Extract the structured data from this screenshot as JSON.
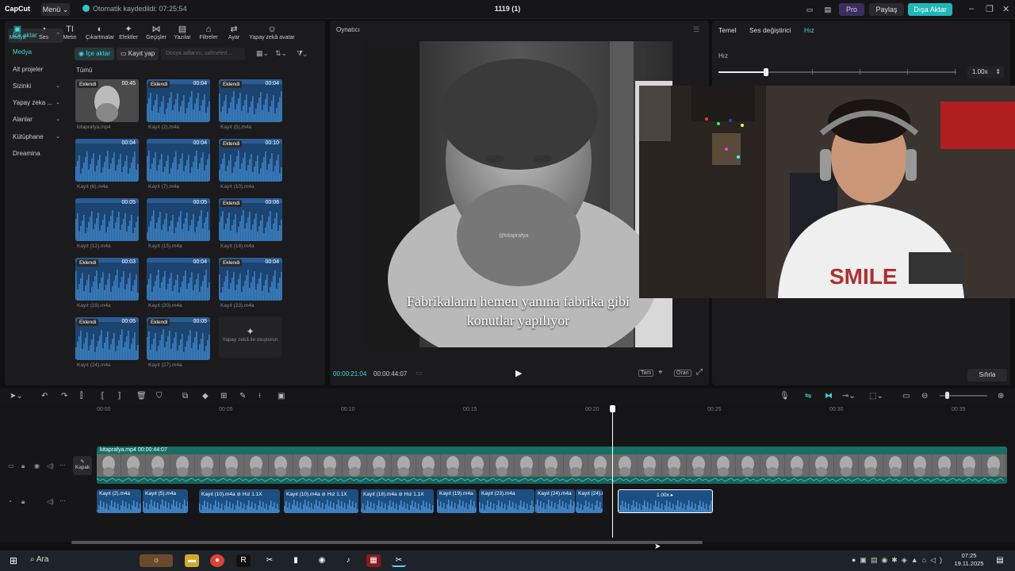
{
  "titlebar": {
    "logo": "CapCut",
    "menu": "Menü ⌄",
    "autosave": "Otomatik kaydedildi: 07:25:54",
    "project_title": "1119 (1)",
    "pro": "Pro",
    "share": "Paylaş",
    "export": "Dışa Aktar"
  },
  "categories": [
    {
      "label": "Medya",
      "icon": "▣"
    },
    {
      "label": "Ses",
      "icon": "◔"
    },
    {
      "label": "Metin",
      "icon": "TI"
    },
    {
      "label": "Çıkartmalar",
      "icon": "◐"
    },
    {
      "label": "Efektler",
      "icon": "✦"
    },
    {
      "label": "Geçişler",
      "icon": "⋈"
    },
    {
      "label": "Yazılar",
      "icon": "▤"
    },
    {
      "label": "Filtreler",
      "icon": "⌂"
    },
    {
      "label": "Ayar",
      "icon": "⇄"
    },
    {
      "label": "Yapay zekâ avatar",
      "icon": "☺"
    }
  ],
  "sidenav": [
    {
      "label": "İçe aktar",
      "chev": "⌃"
    },
    {
      "label": "Medya",
      "chev": ""
    },
    {
      "label": "Alt projeler",
      "chev": ""
    },
    {
      "label": "Sizinki",
      "chev": "⌄"
    },
    {
      "label": "Yapay zeka ...",
      "chev": "⌄"
    },
    {
      "label": "Alanlar",
      "chev": "⌄"
    },
    {
      "label": "Kütüphane",
      "chev": "⌄"
    },
    {
      "label": "Dreamina",
      "chev": ""
    }
  ],
  "media_toolbar": {
    "import": "İçe aktar",
    "record": "Kayıt yap",
    "search_placeholder": "Dosya adlarını, sahneleri..."
  },
  "tumu": "Tümü",
  "media": [
    {
      "name": "kitaprafya.mp4",
      "dur": "00:45",
      "badge": "Eklendi",
      "video": true
    },
    {
      "name": "Kayıt (2).m4a",
      "dur": "00:04",
      "badge": "Eklendi"
    },
    {
      "name": "Kayıt (5).m4a",
      "dur": "00:04",
      "badge": "Eklendi"
    },
    {
      "name": "Kayıt (6).m4a",
      "dur": "00:04",
      "badge": ""
    },
    {
      "name": "Kayıt (7).m4a",
      "dur": "00:04",
      "badge": ""
    },
    {
      "name": "Kayıt (10).m4a",
      "dur": "00:10",
      "badge": "Eklendi"
    },
    {
      "name": "Kayıt (12).m4a",
      "dur": "00:05",
      "badge": ""
    },
    {
      "name": "Kayıt (15).m4a",
      "dur": "00:05",
      "badge": ""
    },
    {
      "name": "Kayıt (18).m4a",
      "dur": "00:06",
      "badge": "Eklendi"
    },
    {
      "name": "Kayıt (19).m4a",
      "dur": "00:03",
      "badge": "Eklendi"
    },
    {
      "name": "Kayıt (20).m4a",
      "dur": "00:04",
      "badge": ""
    },
    {
      "name": "Kayıt (23).m4a",
      "dur": "00:04",
      "badge": "Eklendi"
    },
    {
      "name": "Kayıt (24).m4a",
      "dur": "00:05",
      "badge": "Eklendi"
    },
    {
      "name": "Kayıt (27).m4a",
      "dur": "00:05",
      "badge": "Eklendi"
    }
  ],
  "ai_tile": "Yapay zekâ ile oluşturun",
  "player": {
    "title": "Oynatıcı",
    "watermark": "@kitaprafya",
    "subtitle_line1": "Fabrikaların hemen yanına fabrika gibi",
    "subtitle_line2": "konutlar yapılıyor",
    "time_current": "00:00:21:04",
    "time_total": "00:00:44:07",
    "btn_full": "Tam",
    "btn_ratio": "Oran"
  },
  "right_panel": {
    "tabs": [
      "Temel",
      "Ses değiştirici",
      "Hız"
    ],
    "speed_label": "Hız",
    "speed_value": "1.00x",
    "speed_level": 0.2,
    "reset": "Sıfırla"
  },
  "ruler": [
    "00:00",
    "00:05",
    "00:10",
    "00:15",
    "00:20",
    "00:25",
    "00:30",
    "00:35"
  ],
  "timeline": {
    "cover": "Kapak",
    "video_clip": "kitaprafya.mp4   00:00:44:07",
    "audio_clips": [
      {
        "label": "Kayıt (2).m4a"
      },
      {
        "label": "Kayıt (5).m4a"
      },
      {
        "label": "Kayıt (10).m4a   ⊘ Hız 1.1X"
      },
      {
        "label": "Kayıt (10).m4a   ⊘ Hız 1.1X"
      },
      {
        "label": "Kayıt (18).m4a   ⊘ Hız 1.1X"
      },
      {
        "label": "Kayıt (19).m4a"
      },
      {
        "label": "Kayıt (23).m4a"
      },
      {
        "label": "Kayıt (24).m4a"
      },
      {
        "label": "Kayıt (24).r"
      },
      {
        "label": "1.00x ▸"
      }
    ]
  },
  "taskbar": {
    "search": "Ara",
    "time": "07:25",
    "date": "19.11.2025"
  }
}
